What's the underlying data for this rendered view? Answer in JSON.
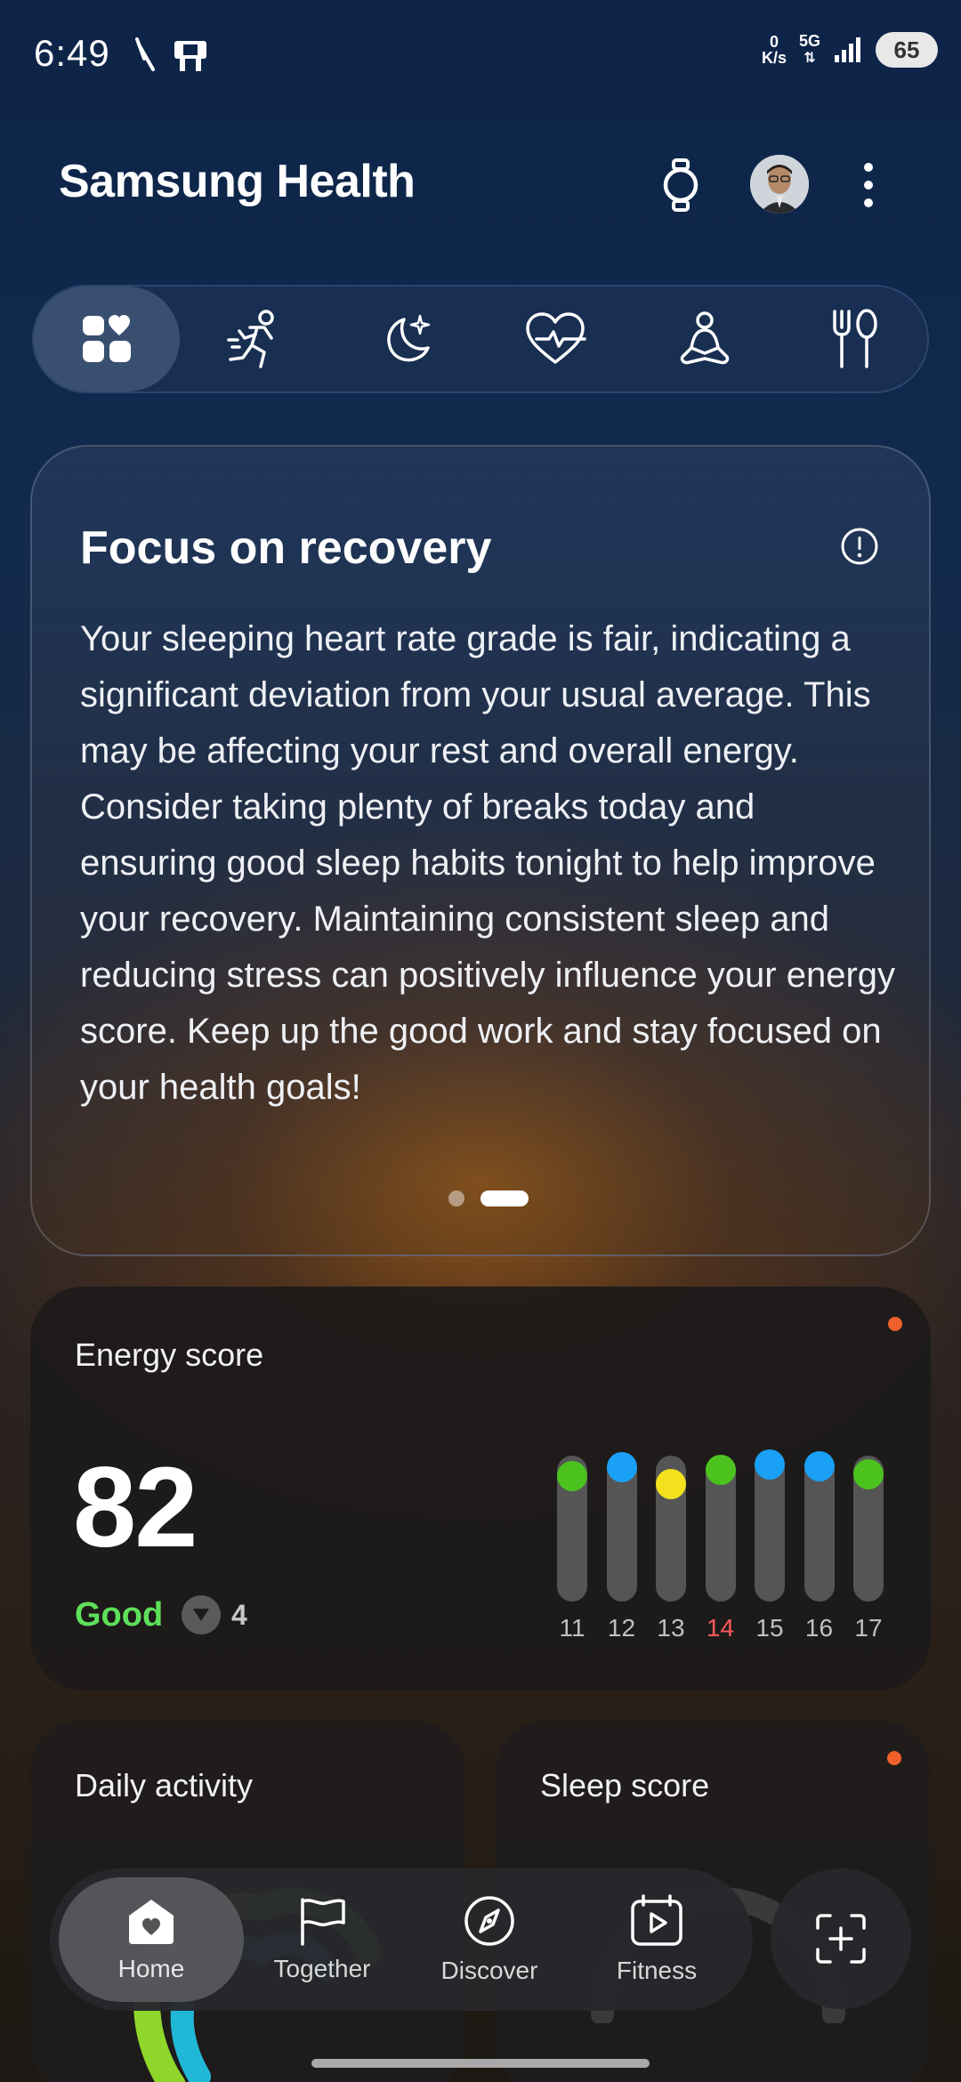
{
  "status_bar": {
    "time": "6:49",
    "net_speed_value": "0",
    "net_speed_unit": "K/s",
    "network_type": "5G",
    "battery": "65"
  },
  "header": {
    "app_title": "Samsung Health"
  },
  "category_tabs": [
    {
      "icon": "dashboard-icon",
      "active": true
    },
    {
      "icon": "running-icon",
      "active": false
    },
    {
      "icon": "moon-icon",
      "active": false
    },
    {
      "icon": "heart-rate-icon",
      "active": false
    },
    {
      "icon": "meditation-icon",
      "active": false
    },
    {
      "icon": "fork-spoon-icon",
      "active": false
    }
  ],
  "insight": {
    "title": "Focus on recovery",
    "body": "Your sleeping heart rate grade is fair, indicating a significant deviation from your usual average. This may be affecting your rest and overall energy. Consider taking plenty of breaks today and ensuring good sleep habits tonight to help improve your recovery. Maintaining consistent sleep and reducing stress can positively influence your energy score. Keep up the good work and stay focused on your health goals!",
    "page_count": 2,
    "active_page": 2
  },
  "energy": {
    "label": "Energy score",
    "value": "82",
    "status": "Good",
    "delta": "4",
    "days": [
      {
        "day": "11",
        "color": "#4cc21f",
        "level": 0.85,
        "highlight": false
      },
      {
        "day": "12",
        "color": "#1aa0f5",
        "level": 0.92,
        "highlight": false
      },
      {
        "day": "13",
        "color": "#f2e11c",
        "level": 0.78,
        "highlight": false
      },
      {
        "day": "14",
        "color": "#4cc21f",
        "level": 0.9,
        "highlight": true
      },
      {
        "day": "15",
        "color": "#1aa0f5",
        "level": 0.95,
        "highlight": false
      },
      {
        "day": "16",
        "color": "#1aa0f5",
        "level": 0.93,
        "highlight": false
      },
      {
        "day": "17",
        "color": "#4cc21f",
        "level": 0.86,
        "highlight": false
      }
    ]
  },
  "daily_activity": {
    "label": "Daily activity"
  },
  "sleep": {
    "label": "Sleep score"
  },
  "bottom_nav": {
    "items": [
      {
        "label": "Home",
        "icon": "home-heart-icon",
        "active": true
      },
      {
        "label": "Together",
        "icon": "flag-icon",
        "active": false
      },
      {
        "label": "Discover",
        "icon": "compass-icon",
        "active": false
      },
      {
        "label": "Fitness",
        "icon": "video-calendar-icon",
        "active": false
      }
    ]
  },
  "colors": {
    "good": "#5ee05a",
    "notification": "#f0602a",
    "highlight_day": "#ff5b5b"
  }
}
